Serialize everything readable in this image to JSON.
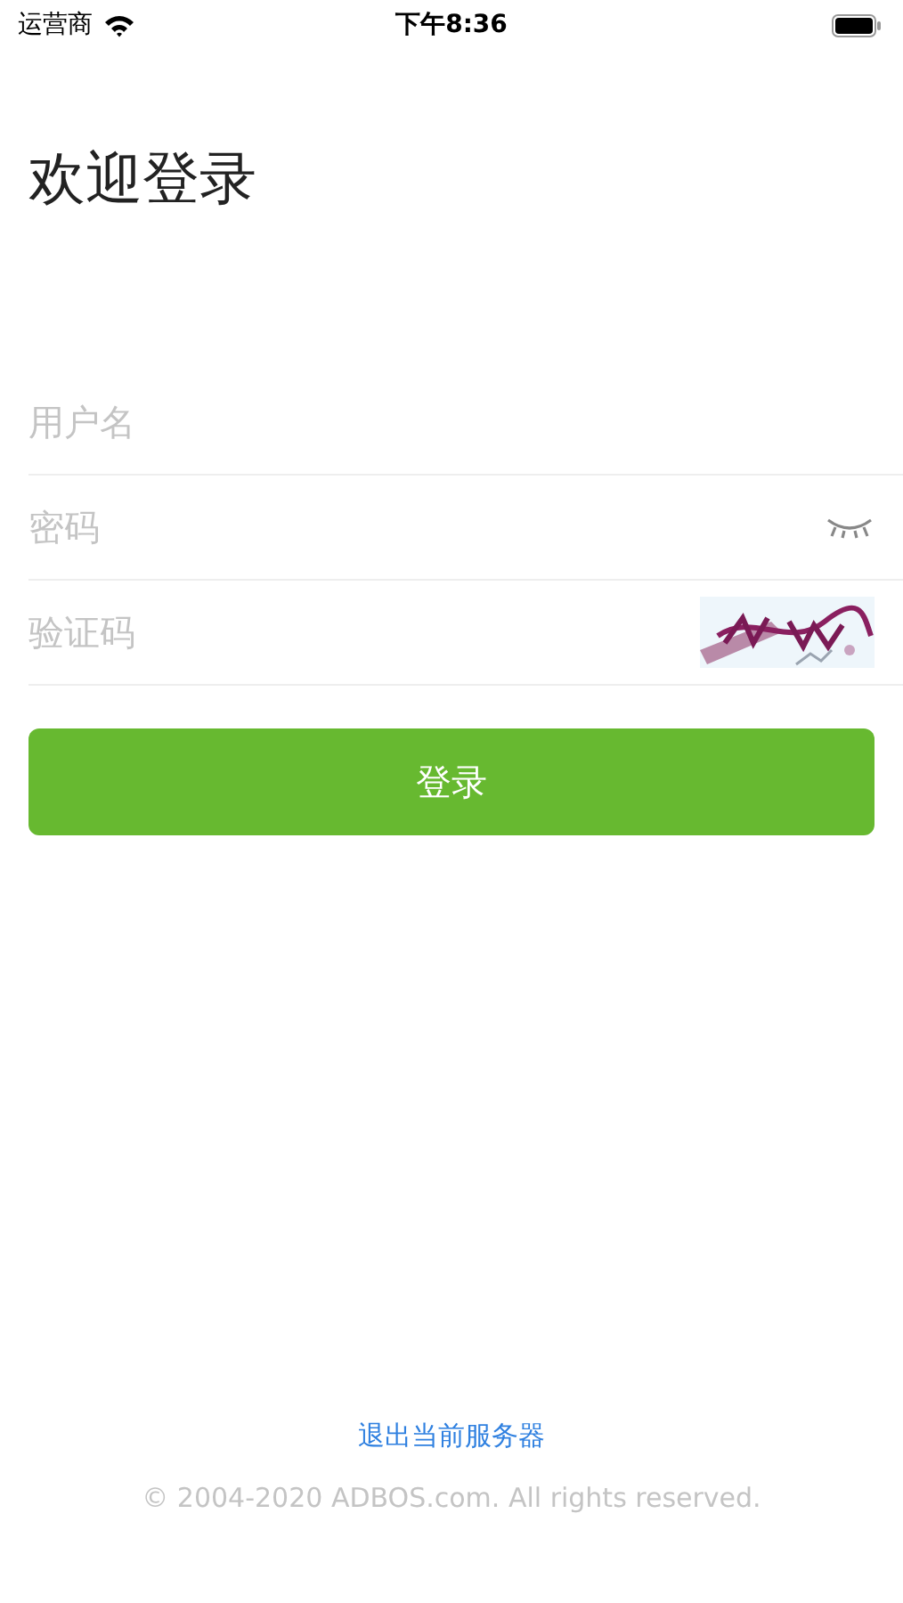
{
  "status_bar": {
    "carrier": "运营商",
    "time": "下午8:36"
  },
  "title": "欢迎登录",
  "fields": [
    {
      "kind": "text",
      "placeholder": "用户名"
    },
    {
      "kind": "password",
      "placeholder": "密码"
    },
    {
      "kind": "captcha",
      "placeholder": "验证码"
    }
  ],
  "login_button": "登录",
  "exit_link": "退出当前服务器",
  "copyright": "© 2004-2020 ADBOS.com. All rights reserved."
}
